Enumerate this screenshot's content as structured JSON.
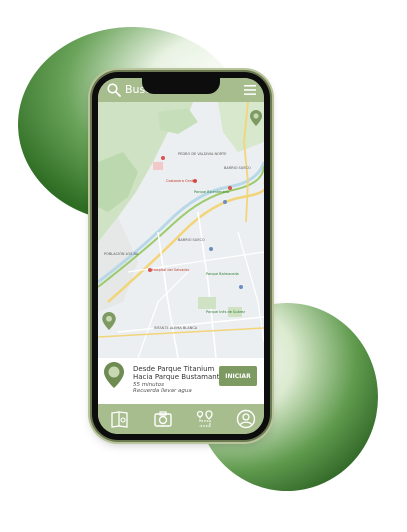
{
  "search": {
    "placeholder": "Buscar ruta"
  },
  "map": {
    "labels": [
      {
        "text": "PEDRO DE VALDIVIA NORTE",
        "tone": "gray"
      },
      {
        "text": "BARRIO SUECO",
        "tone": "gray"
      },
      {
        "text": "Costanera Center",
        "tone": "red"
      },
      {
        "text": "Parque Bicentenario",
        "tone": "green"
      },
      {
        "text": "BARRIO SUECO",
        "tone": "gray"
      },
      {
        "text": "Parque Balmaceda",
        "tone": "green"
      },
      {
        "text": "Hospital del Salvador",
        "tone": "red"
      },
      {
        "text": "Parque Inés de Suárez",
        "tone": "green"
      },
      {
        "text": "INFANTE ALEMA BLANCA",
        "tone": "gray"
      },
      {
        "text": "POBLACIÓN LOS BA",
        "tone": "gray"
      }
    ]
  },
  "route": {
    "from": "Desde Parque Titanium",
    "to": "Hacia Parque Bustamante",
    "duration": "55 minutos",
    "note": "Recuerda llevar agua",
    "start_label": "INICIAR"
  },
  "nav": {
    "items": [
      {
        "icon": "map-book-icon"
      },
      {
        "icon": "camera-icon"
      },
      {
        "icon": "route-icon"
      },
      {
        "icon": "profile-icon"
      }
    ]
  },
  "colors": {
    "accent": "#a8bd8e",
    "button": "#7e9a63",
    "blob_dark": "#2f6e24"
  }
}
